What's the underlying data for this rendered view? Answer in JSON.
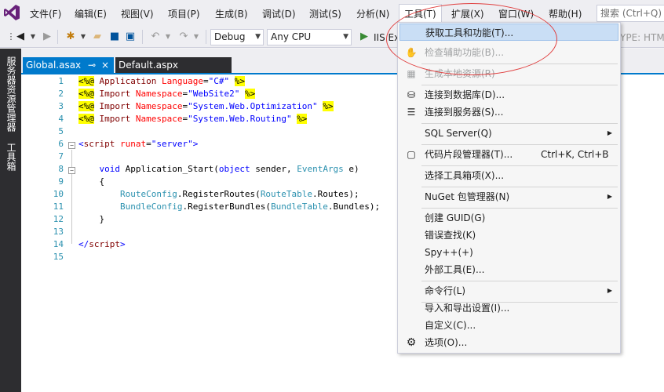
{
  "menubar": {
    "items": [
      "文件(F)",
      "编辑(E)",
      "视图(V)",
      "项目(P)",
      "生成(B)",
      "调试(D)",
      "测试(S)",
      "分析(N)",
      "工具(T)",
      "扩展(X)",
      "窗口(W)",
      "帮助(H)"
    ],
    "search_placeholder": "搜索 (Ctrl+Q)"
  },
  "toolbar": {
    "config": "Debug",
    "platform": "Any CPU",
    "run_label": "IIS Ex",
    "type_hint": "YPE: HTM"
  },
  "sidebar": {
    "tabs": [
      "服务器资源管理器",
      "工具箱"
    ]
  },
  "tabs": {
    "active": "Global.asax",
    "pin": "⊸",
    "close": "×",
    "other": "Default.aspx"
  },
  "editor": {
    "line_numbers": [
      "1",
      "2",
      "3",
      "4",
      "5",
      "6",
      "7",
      "8",
      "9",
      "10",
      "11",
      "12",
      "13",
      "14",
      "15"
    ]
  },
  "tools_menu": {
    "items": [
      {
        "label": "获取工具和功能(T)...",
        "icon": "gear-box-icon"
      },
      {
        "label": "检查辅助功能(B)...",
        "icon": "accessibility-icon"
      },
      {
        "label": "生成本地资源(R)",
        "icon": "resource-icon"
      },
      {
        "label": "连接到数据库(D)...",
        "icon": "database-connect-icon"
      },
      {
        "label": "连接到服务器(S)...",
        "icon": "server-connect-icon"
      },
      {
        "label": "SQL Server(Q)"
      },
      {
        "label": "代码片段管理器(T)...",
        "shortcut": "Ctrl+K, Ctrl+B",
        "icon": "snippet-icon"
      },
      {
        "label": "选择工具箱项(X)..."
      },
      {
        "label": "NuGet 包管理器(N)"
      },
      {
        "label": "创建 GUID(G)"
      },
      {
        "label": "错误查找(K)"
      },
      {
        "label": "Spy++(+)"
      },
      {
        "label": "外部工具(E)..."
      },
      {
        "label": "命令行(L)"
      },
      {
        "label": "导入和导出设置(I)..."
      },
      {
        "label": "自定义(C)..."
      },
      {
        "label": "选项(O)...",
        "icon": "gear-icon"
      }
    ]
  },
  "colors": {
    "accent": "#007acc",
    "menu_highlight": "#c9def5",
    "annotation": "#e04040"
  }
}
